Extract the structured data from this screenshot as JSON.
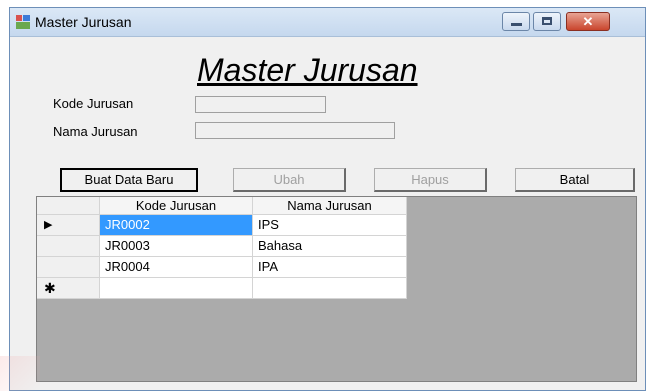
{
  "window": {
    "title": "Master Jurusan",
    "heading": "Master Jurusan",
    "close_glyph": "✕"
  },
  "form": {
    "kode_label": "Kode Jurusan",
    "kode_value": "",
    "nama_label": "Nama Jurusan",
    "nama_value": ""
  },
  "buttons": {
    "buat": "Buat Data Baru",
    "ubah": "Ubah",
    "hapus": "Hapus",
    "batal": "Batal"
  },
  "grid": {
    "columns": [
      "Kode Jurusan",
      "Nama Jurusan"
    ],
    "rows": [
      {
        "kode": "JR0002",
        "nama": "IPS",
        "marker": "▶",
        "selected": true
      },
      {
        "kode": "JR0003",
        "nama": "Bahasa",
        "marker": "",
        "selected": false
      },
      {
        "kode": "JR0004",
        "nama": "IPA",
        "marker": "",
        "selected": false
      }
    ],
    "new_row_marker": "✱"
  },
  "colors": {
    "selection": "#3399ff",
    "grid_background": "#ababab",
    "close_button": "#c9452d"
  }
}
